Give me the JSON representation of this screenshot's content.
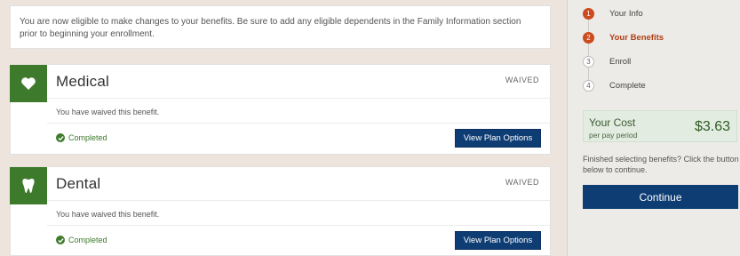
{
  "notice": {
    "text": "You are now eligible to make changes to your benefits. Be sure to add any eligible dependents in the Family Information section prior to beginning your enrollment."
  },
  "benefits": [
    {
      "title": "Medical",
      "status": "WAIVED",
      "message": "You have waived this benefit.",
      "completed_label": "Completed",
      "button_label": "View Plan Options",
      "icon": "heart-icon"
    },
    {
      "title": "Dental",
      "status": "WAIVED",
      "message": "You have waived this benefit.",
      "completed_label": "Completed",
      "button_label": "View Plan Options",
      "icon": "tooth-icon"
    }
  ],
  "steps": [
    {
      "number": "1",
      "label": "Your Info",
      "state": "done"
    },
    {
      "number": "2",
      "label": "Your Benefits",
      "state": "current"
    },
    {
      "number": "3",
      "label": "Enroll",
      "state": "upcoming"
    },
    {
      "number": "4",
      "label": "Complete",
      "state": "upcoming"
    }
  ],
  "cost": {
    "label": "Your Cost",
    "sublabel": "per pay period",
    "amount": "$3.63"
  },
  "finished_text": "Finished selecting benefits? Click the button below to continue.",
  "continue_label": "Continue",
  "colors": {
    "accent_blue": "#0e3d73",
    "benefit_green": "#3e7a2c",
    "step_orange": "#cc4a1e"
  }
}
